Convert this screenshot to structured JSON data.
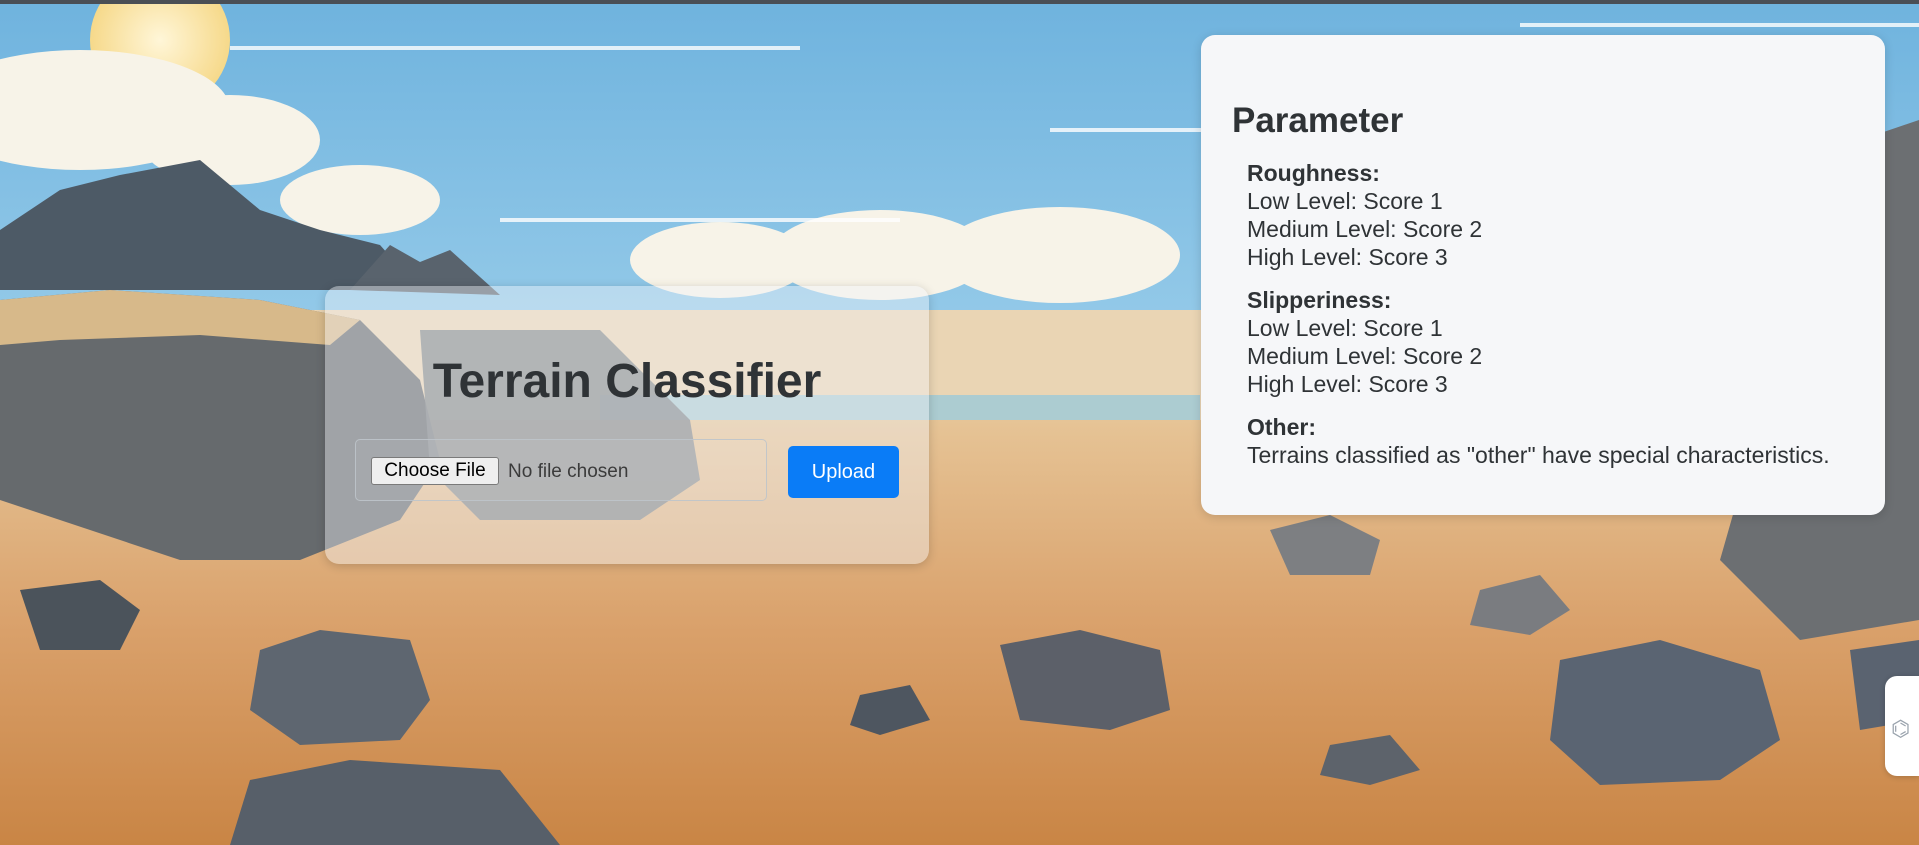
{
  "app": {
    "title": "Terrain Classifier",
    "file_input": {
      "button_label": "Choose File",
      "status_text": "No file chosen"
    },
    "upload_label": "Upload"
  },
  "parameters": {
    "title": "Parameter",
    "groups": [
      {
        "heading": "Roughness:",
        "lines": [
          "Low Level: Score 1",
          "Medium Level: Score 2",
          "High Level: Score 3"
        ]
      },
      {
        "heading": "Slipperiness:",
        "lines": [
          "Low Level: Score 1",
          "Medium Level: Score 2",
          "High Level: Score 3"
        ]
      },
      {
        "heading": "Other:",
        "lines": [
          "Terrains classified as \"other\" have special characteristics."
        ]
      }
    ]
  },
  "side_handle": {
    "icon": "grip-icon"
  },
  "colors": {
    "accent": "#0a7cf7",
    "card": "#f6f7f9",
    "text": "#2f3336",
    "sky": "#8ec8e6",
    "sand": "#d9a06a"
  }
}
